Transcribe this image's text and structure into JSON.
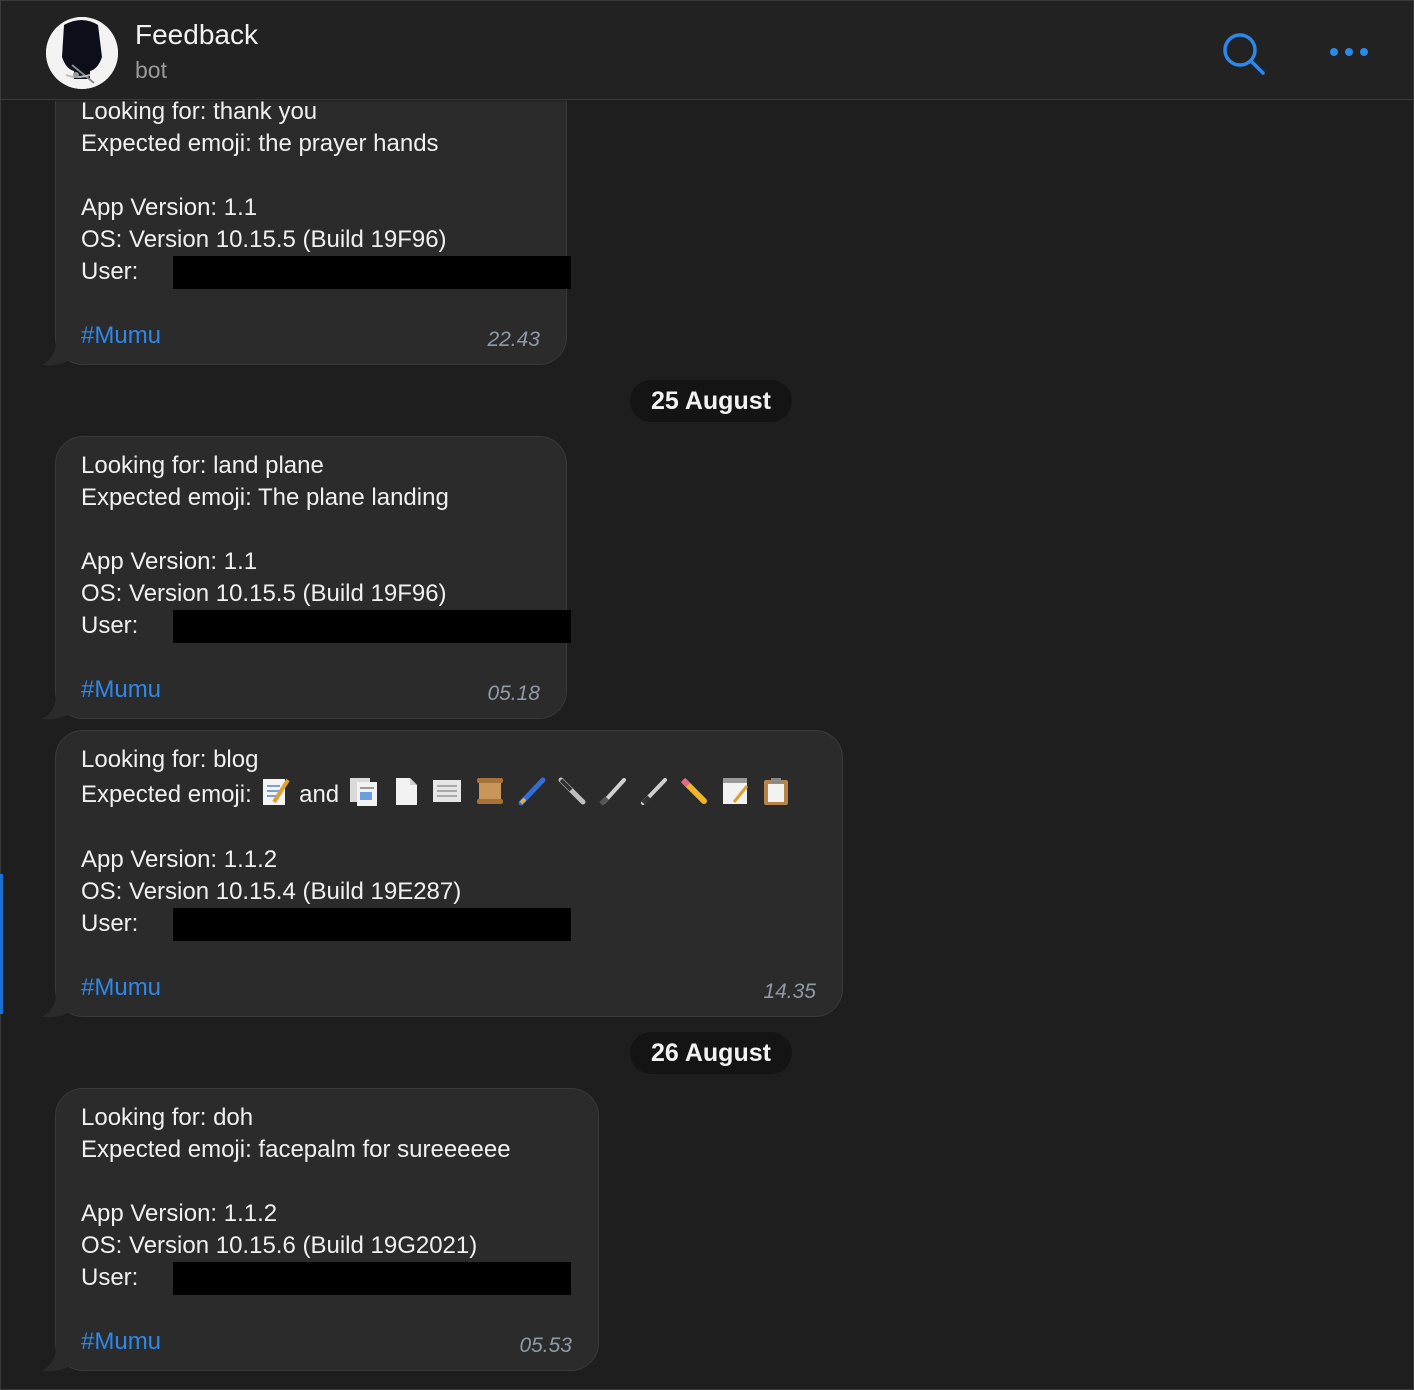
{
  "header": {
    "title": "Feedback",
    "subtitle": "bot",
    "accent": "#2c88ea"
  },
  "messages": [
    {
      "line1": "Looking for: thank you",
      "line2": "Expected emoji: the prayer hands",
      "app": "App Version: 1.1",
      "os": "OS: Version 10.15.5 (Build 19F96)",
      "user": "User:",
      "tag": "#Mumu",
      "time": "22.43"
    },
    {
      "line1": "Looking for: land plane",
      "line2": "Expected emoji: The plane landing",
      "app": "App Version: 1.1",
      "os": "OS: Version 10.15.5 (Build 19F96)",
      "user": "User:",
      "tag": "#Mumu",
      "time": "05.18"
    },
    {
      "line1": "Looking for: blog",
      "line2_prefix": "Expected emoji:",
      "line2_and": "and",
      "app": "App Version: 1.1.2",
      "os": "OS: Version 10.15.4 (Build 19E287)",
      "user": "User:",
      "tag": "#Mumu",
      "time": "14.35",
      "emoji_icons": [
        "memo-icon",
        "page-facing-up-icon",
        "page-icon",
        "newspaper-icon",
        "scroll-icon",
        "pen-icon",
        "fountain-pen-icon",
        "paintbrush-icon",
        "pen-icon",
        "pencil-icon",
        "notepad-icon",
        "clipboard-icon"
      ]
    },
    {
      "line1": "Looking for: doh",
      "line2": "Expected emoji: facepalm for sureeeeee",
      "app": "App Version: 1.1.2",
      "os": "OS: Version 10.15.6 (Build 19G2021)",
      "user": "User:",
      "tag": "#Mumu",
      "time": "05.53"
    }
  ],
  "dates": [
    "25 August",
    "26 August"
  ]
}
